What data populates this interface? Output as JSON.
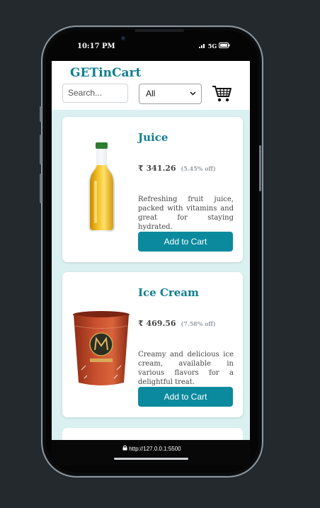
{
  "status": {
    "time": "10:17 PM",
    "network": "5G"
  },
  "header": {
    "brand": "GETinCart",
    "search_placeholder": "Search...",
    "filter_value": "All"
  },
  "products": [
    {
      "name": "Juice",
      "price": "₹ 341.26",
      "discount": "(5.45% off)",
      "description": "Refreshing fruit juice, packed with vitamins and great for staying hydrated.",
      "button": "Add to Cart"
    },
    {
      "name": "Ice Cream",
      "price": "₹ 469.56",
      "discount": "(7.58% off)",
      "description": "Creamy and delicious ice cream, available in various flavors for a delightful treat.",
      "button": "Add to Cart"
    }
  ],
  "browser": {
    "url": "http://127.0.0.1:5500"
  },
  "icons": [
    "cart-icon",
    "lock-icon",
    "signal-icon",
    "battery-icon",
    "chevron-down-icon"
  ],
  "colors": {
    "brand": "#0e7e8f",
    "button": "#0b8a9e",
    "screen_bg": "#daf0f1",
    "backdrop": "#24292d"
  }
}
